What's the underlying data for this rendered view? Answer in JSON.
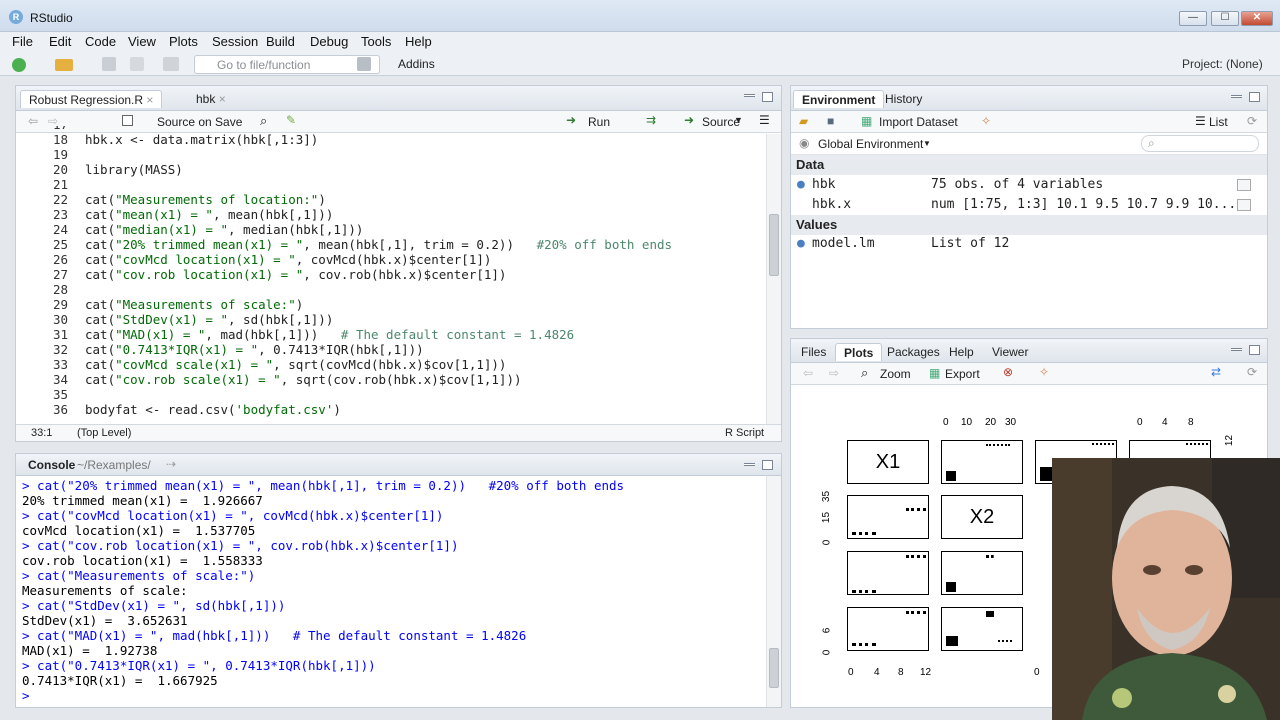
{
  "window": {
    "title": "RStudio",
    "minimize": "—",
    "maximize": "☐",
    "close": "✕"
  },
  "menu": [
    "File",
    "Edit",
    "Code",
    "View",
    "Plots",
    "Session",
    "Build",
    "Debug",
    "Tools",
    "Help"
  ],
  "toolbar": {
    "goto_placeholder": "Go to file/function",
    "addins": "Addins",
    "project": "Project: (None)"
  },
  "editor": {
    "tabs": [
      {
        "label": "Robust Regression.R"
      },
      {
        "label": "hbk"
      }
    ],
    "source_on_save": "Source on Save",
    "run": "Run",
    "source": "Source",
    "lines": [
      {
        "n": "17",
        "text": ""
      },
      {
        "n": "18",
        "text": "hbk.x <- data.matrix(hbk[,1:3])"
      },
      {
        "n": "19",
        "text": ""
      },
      {
        "n": "20",
        "text": "library(MASS)"
      },
      {
        "n": "21",
        "text": ""
      },
      {
        "n": "22",
        "text": "cat(\"Measurements of location:\")"
      },
      {
        "n": "23",
        "text": "cat(\"mean(x1) = \", mean(hbk[,1]))"
      },
      {
        "n": "24",
        "text": "cat(\"median(x1) = \", median(hbk[,1]))"
      },
      {
        "n": "25",
        "text": "cat(\"20% trimmed mean(x1) = \", mean(hbk[,1], trim = 0.2))   #20% off both ends"
      },
      {
        "n": "26",
        "text": "cat(\"covMcd location(x1) = \", covMcd(hbk.x)$center[1])"
      },
      {
        "n": "27",
        "text": "cat(\"cov.rob location(x1) = \", cov.rob(hbk.x)$center[1])"
      },
      {
        "n": "28",
        "text": ""
      },
      {
        "n": "29",
        "text": "cat(\"Measurements of scale:\")"
      },
      {
        "n": "30",
        "text": "cat(\"StdDev(x1) = \", sd(hbk[,1]))"
      },
      {
        "n": "31",
        "text": "cat(\"MAD(x1) = \", mad(hbk[,1]))   # The default constant = 1.4826"
      },
      {
        "n": "32",
        "text": "cat(\"0.7413*IQR(x1) = \", 0.7413*IQR(hbk[,1]))"
      },
      {
        "n": "33",
        "text": "cat(\"covMcd scale(x1) = \", sqrt(covMcd(hbk.x)$cov[1,1]))"
      },
      {
        "n": "34",
        "text": "cat(\"cov.rob scale(x1) = \", sqrt(cov.rob(hbk.x)$cov[1,1]))"
      },
      {
        "n": "35",
        "text": ""
      },
      {
        "n": "36",
        "text": "bodyfat <- read.csv('bodyfat.csv')"
      }
    ],
    "status_pos": "33:1",
    "status_scope": "(Top Level)",
    "status_type": "R Script"
  },
  "console": {
    "title": "Console",
    "path": "~/Rexamples/",
    "lines": [
      {
        "t": "cmd",
        "text": "> cat(\"20% trimmed mean(x1) = \", mean(hbk[,1], trim = 0.2))   #20% off both ends"
      },
      {
        "t": "out",
        "text": "20% trimmed mean(x1) =  1.926667"
      },
      {
        "t": "cmd",
        "text": "> cat(\"covMcd location(x1) = \", covMcd(hbk.x)$center[1])"
      },
      {
        "t": "out",
        "text": "covMcd location(x1) =  1.537705"
      },
      {
        "t": "cmd",
        "text": "> cat(\"cov.rob location(x1) = \", cov.rob(hbk.x)$center[1])"
      },
      {
        "t": "out",
        "text": "cov.rob location(x1) =  1.558333"
      },
      {
        "t": "cmd",
        "text": "> cat(\"Measurements of scale:\")"
      },
      {
        "t": "out",
        "text": "Measurements of scale:"
      },
      {
        "t": "cmd",
        "text": "> cat(\"StdDev(x1) = \", sd(hbk[,1]))"
      },
      {
        "t": "out",
        "text": "StdDev(x1) =  3.652631"
      },
      {
        "t": "cmd",
        "text": "> cat(\"MAD(x1) = \", mad(hbk[,1]))   # The default constant = 1.4826"
      },
      {
        "t": "out",
        "text": "MAD(x1) =  1.92738"
      },
      {
        "t": "cmd",
        "text": "> cat(\"0.7413*IQR(x1) = \", 0.7413*IQR(hbk[,1]))"
      },
      {
        "t": "out",
        "text": "0.7413*IQR(x1) =  1.667925"
      },
      {
        "t": "cmd",
        "text": "> "
      }
    ]
  },
  "environment": {
    "tabs": [
      "Environment",
      "History"
    ],
    "import": "Import Dataset",
    "list": "List",
    "scope": "Global Environment",
    "sections": {
      "data": "Data",
      "values": "Values"
    },
    "data_rows": [
      {
        "name": "hbk",
        "value": "75 obs. of 4 variables"
      },
      {
        "name": "hbk.x",
        "value": "num [1:75, 1:3] 10.1 9.5 10.7 9.9 10..."
      }
    ],
    "value_rows": [
      {
        "name": "model.lm",
        "value": "List of 12"
      }
    ]
  },
  "files": {
    "tabs": [
      "Files",
      "Plots",
      "Packages",
      "Help",
      "Viewer"
    ],
    "zoom": "Zoom",
    "export": "Export"
  },
  "plot": {
    "diag_labels": [
      "X1",
      "X2"
    ],
    "top_ticks_col2": [
      "0",
      "10",
      "20",
      "30"
    ],
    "top_ticks_col4": [
      "0",
      "4",
      "8"
    ],
    "left_ticks_row2": [
      "0",
      "15",
      "35"
    ],
    "left_ticks_row4": [
      "0",
      "6"
    ],
    "bottom_ticks_col1": [
      "0",
      "4",
      "8",
      "12"
    ],
    "bottom_ticks_col3": [
      "0"
    ],
    "right_tick_row1": "12"
  },
  "colors": {
    "accent": "#75aadb",
    "string": "#036a07",
    "comment": "#4c886b",
    "console_cmd": "#0000ff"
  }
}
